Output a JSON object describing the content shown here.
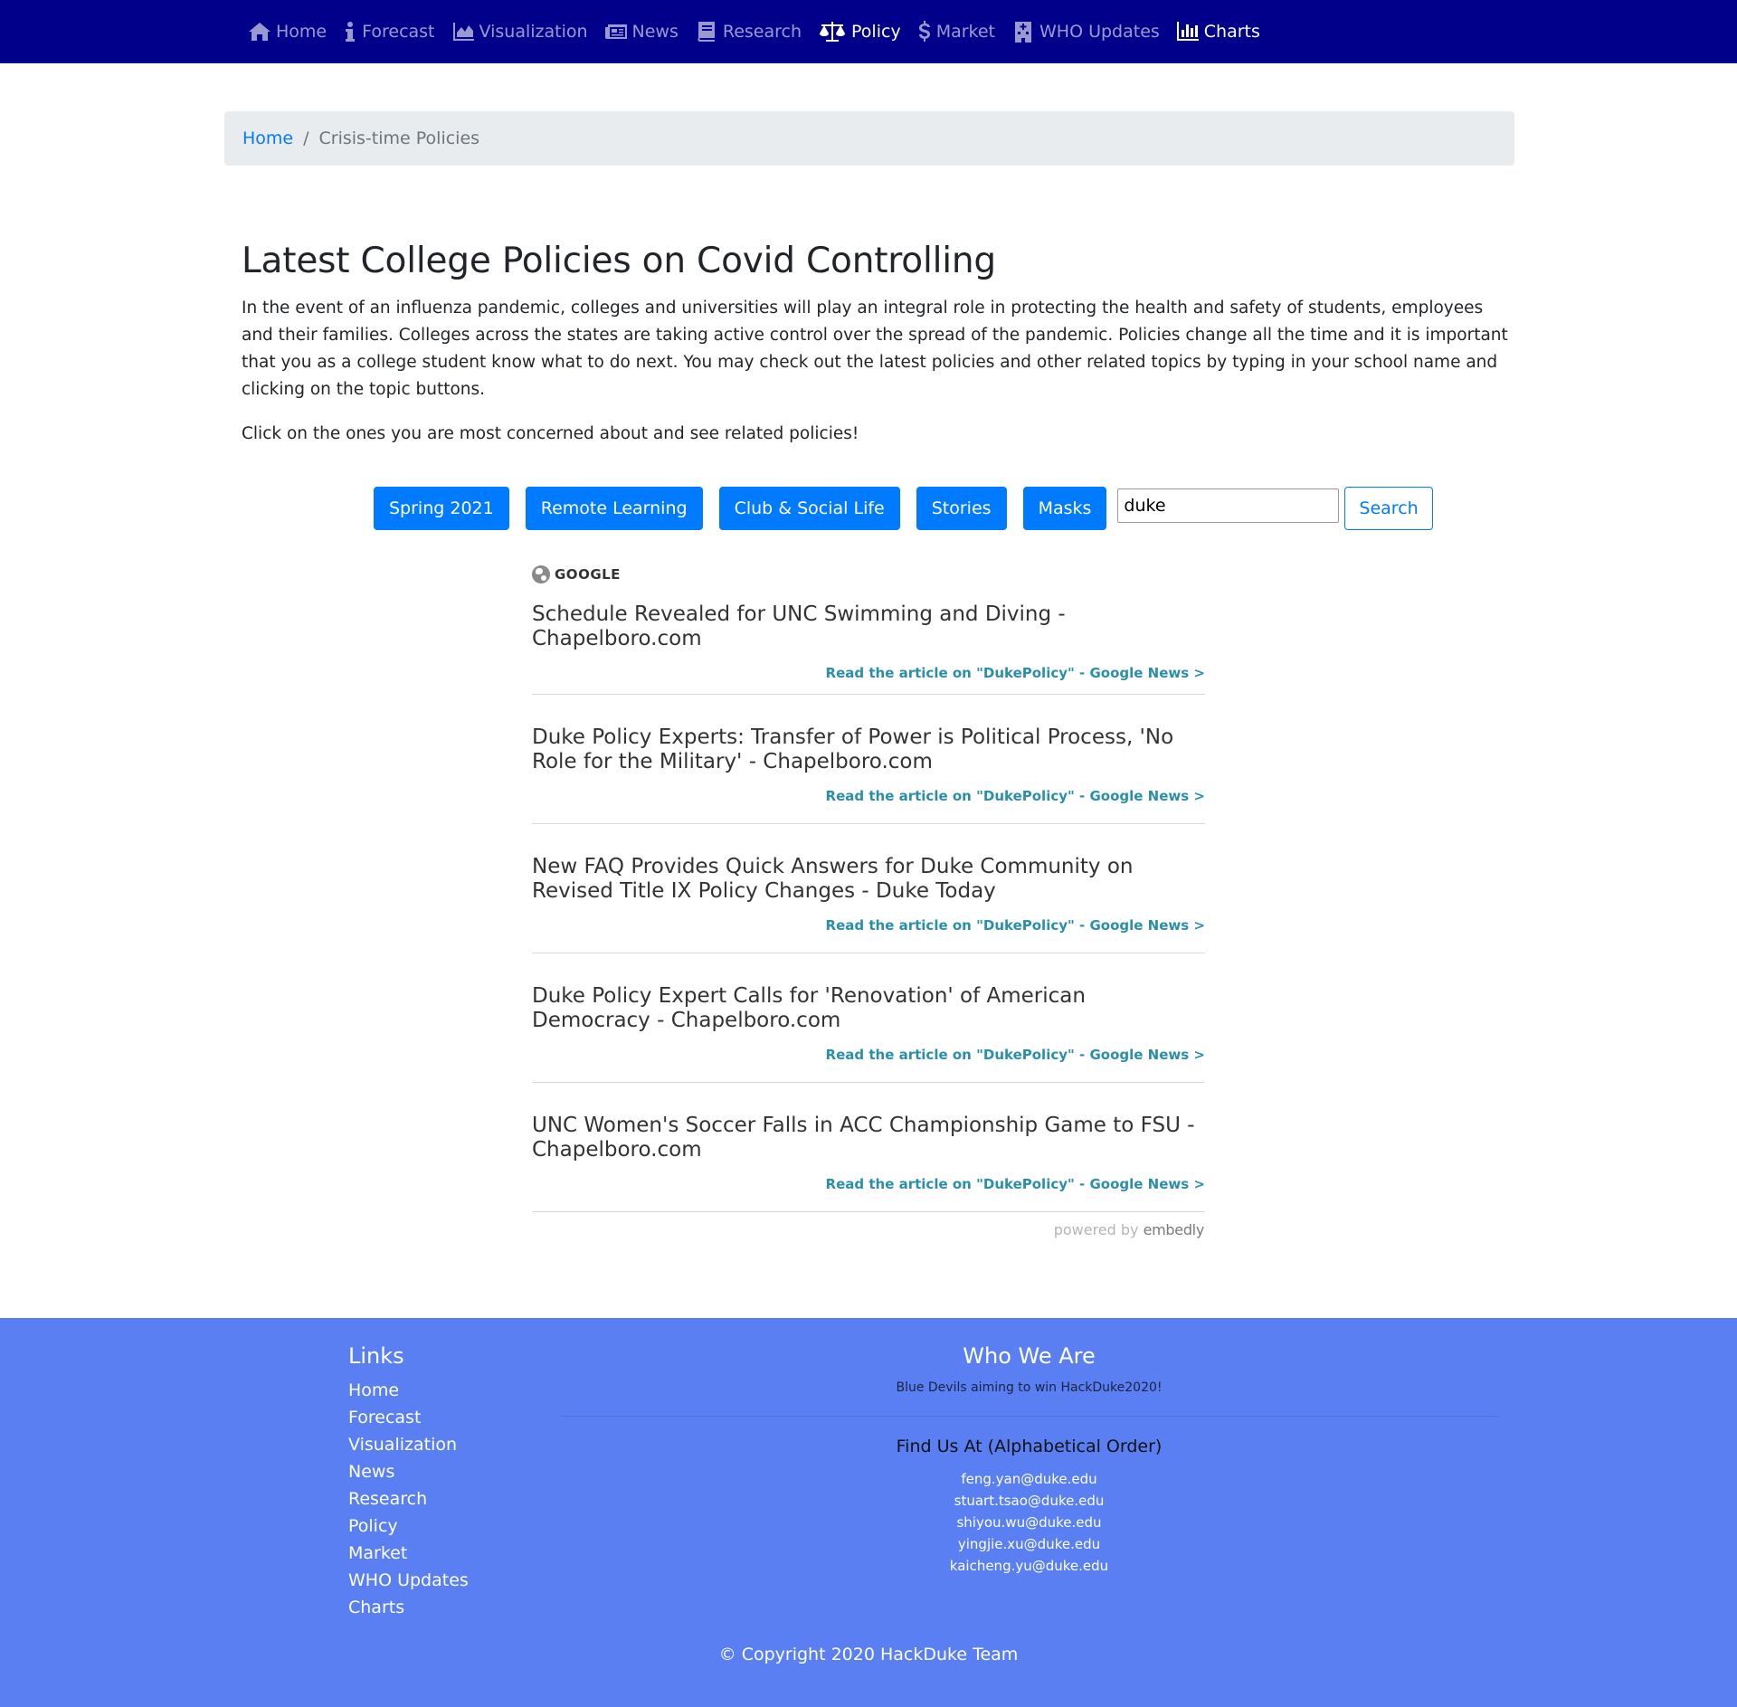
{
  "nav": {
    "items": [
      {
        "label": "Home",
        "icon": "home-icon"
      },
      {
        "label": "Forecast",
        "icon": "info-icon"
      },
      {
        "label": "Visualization",
        "icon": "area-chart-icon"
      },
      {
        "label": "News",
        "icon": "newspaper-icon"
      },
      {
        "label": "Research",
        "icon": "book-icon"
      },
      {
        "label": "Policy",
        "icon": "balance-scale-icon",
        "active": true
      },
      {
        "label": "Market",
        "icon": "dollar-icon"
      },
      {
        "label": "WHO Updates",
        "icon": "hospital-icon"
      },
      {
        "label": "Charts",
        "icon": "bar-chart-icon",
        "active": true
      }
    ]
  },
  "breadcrumb": {
    "home": "Home",
    "separator": "/",
    "current": "Crisis-time Policies"
  },
  "main": {
    "title": "Latest College Policies on Covid Controlling",
    "intro": "In the event of an influenza pandemic, colleges and universities will play an integral role in protecting the health and safety of students, employees and their families. Colleges across the states are taking active control over the spread of the pandemic. Policies change all the time and it is important that you as a college student know what to do next. You may check out the latest policies and other related topics by typing in your school name and clicking on the topic buttons.",
    "prompt": "Click on the ones you are most concerned about and see related policies!",
    "topics": [
      "Spring 2021",
      "Remote Learning",
      "Club & Social Life",
      "Stories",
      "Masks"
    ],
    "search_value": "duke",
    "search_label": "Search"
  },
  "feed": {
    "source": "GOOGLE",
    "articles": [
      {
        "title": "Schedule Revealed for UNC Swimming and Diving - Chapelboro.com",
        "link": "Read the article on \"DukePolicy\" - Google News >"
      },
      {
        "title": "Duke Policy Experts: Transfer of Power is Political Process, 'No Role for the Military' - Chapelboro.com",
        "link": "Read the article on \"DukePolicy\" - Google News >"
      },
      {
        "title": "New FAQ Provides Quick Answers for Duke Community on Revised Title IX Policy Changes - Duke Today",
        "link": "Read the article on \"DukePolicy\" - Google News >"
      },
      {
        "title": "Duke Policy Expert Calls for 'Renovation' of American Democracy - Chapelboro.com",
        "link": "Read the article on \"DukePolicy\" - Google News >"
      },
      {
        "title": "UNC Women's Soccer Falls in ACC Championship Game to FSU - Chapelboro.com",
        "link": "Read the article on \"DukePolicy\" - Google News >"
      }
    ],
    "powered_prefix": "powered by",
    "powered_brand": "embedly"
  },
  "footer": {
    "links_title": "Links",
    "links": [
      "Home",
      "Forecast",
      "Visualization",
      "News",
      "Research",
      "Policy",
      "Market",
      "WHO Updates",
      "Charts"
    ],
    "who_title": "Who We Are",
    "who_subtitle": "Blue Devils aiming to win HackDuke2020!",
    "find_title": "Find Us At (Alphabetical Order)",
    "emails": [
      "feng.yan@duke.edu",
      "stuart.tsao@duke.edu",
      "shiyou.wu@duke.edu",
      "yingjie.xu@duke.edu",
      "kaicheng.yu@duke.edu"
    ],
    "copyright": "© Copyright 2020 HackDuke Team"
  },
  "colors": {
    "navbar": "#00008b",
    "primary": "#007bff",
    "footer": "#5a7ff3",
    "feed_link": "#2a8fa8"
  }
}
